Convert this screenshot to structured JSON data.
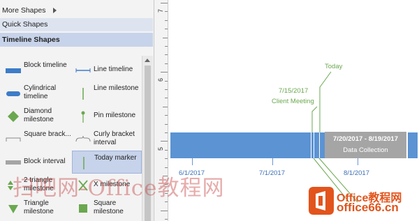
{
  "pane": {
    "more_shapes": "More Shapes",
    "quick_shapes": "Quick Shapes",
    "timeline_shapes": "Timeline Shapes",
    "shapes": [
      {
        "label": "Block timeline",
        "icon": "block-timeline-icon"
      },
      {
        "label": "Line timeline",
        "icon": "line-timeline-icon"
      },
      {
        "label": "Cylindrical timeline",
        "icon": "cylindrical-timeline-icon"
      },
      {
        "label": "Line milestone",
        "icon": "line-milestone-icon"
      },
      {
        "label": "Diamond milestone",
        "icon": "diamond-milestone-icon"
      },
      {
        "label": "Pin milestone",
        "icon": "pin-milestone-icon"
      },
      {
        "label": "Square brack...",
        "icon": "square-bracket-icon"
      },
      {
        "label": "Curly bracket interval",
        "icon": "curly-bracket-icon"
      },
      {
        "label": "Block interval",
        "icon": "block-interval-icon"
      },
      {
        "label": "Today marker",
        "icon": "today-marker-icon"
      },
      {
        "label": "2 triangle milestone",
        "icon": "two-triangle-milestone-icon"
      },
      {
        "label": "X milestone",
        "icon": "x-milestone-icon"
      },
      {
        "label": "Triangle milestone",
        "icon": "triangle-milestone-icon"
      },
      {
        "label": "Square milestone",
        "icon": "square-milestone-icon"
      }
    ]
  },
  "ruler": {
    "labels": [
      "7",
      "6",
      "5"
    ]
  },
  "canvas": {
    "today_label": "Today",
    "meeting_date": "7/15/2017",
    "meeting_label": "Client Meeting",
    "interval_dates": "7/20/2017 - 8/19/2017",
    "interval_label": "Data Collection",
    "dates": [
      "6/1/2017",
      "7/1/2017",
      "8/1/2017"
    ]
  },
  "watermark": {
    "text": "扫吧网-Office教程网",
    "logo_line1": "Office教程网",
    "logo_line2": "office66.cn"
  },
  "colors": {
    "timeline_bar": "#5b93d3",
    "interval_box": "#a5a5a5",
    "milestone_green": "#6aa84f",
    "date_blue": "#3b6fb4",
    "selection": "#c7d3ea"
  }
}
